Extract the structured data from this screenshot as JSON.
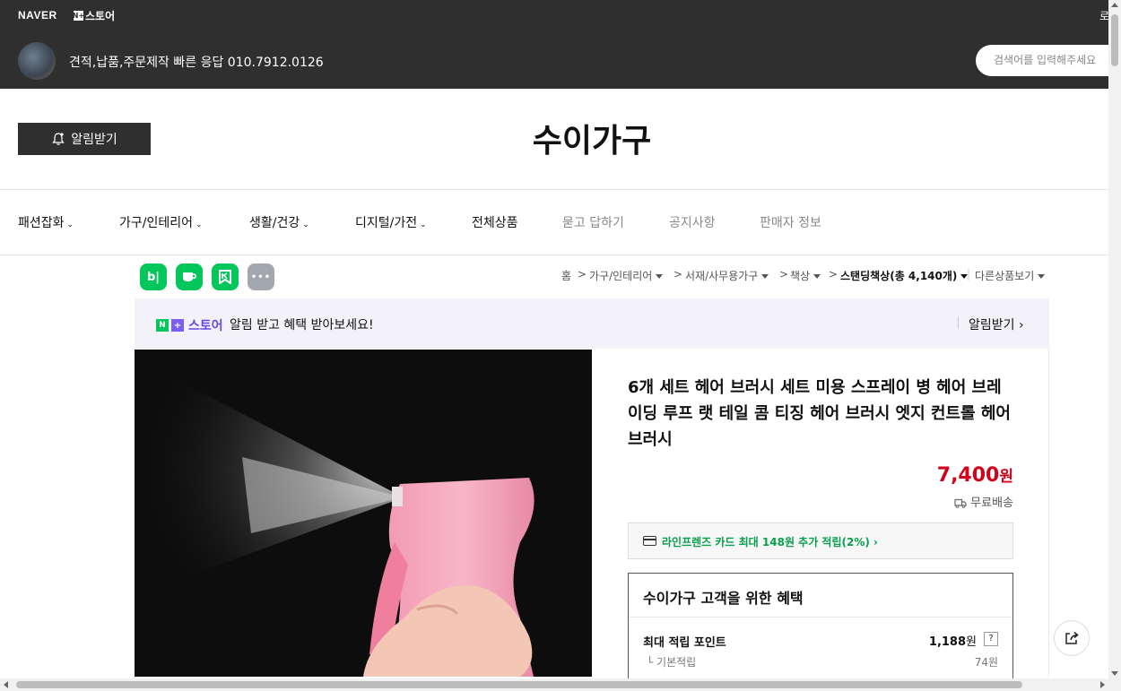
{
  "header": {
    "naver_logo": "NAVER",
    "store_logo_box": "N+",
    "store_logo_text": "스토어",
    "login_cut": "로",
    "seller_description": "견적,납품,주문제작 빠른 응답 010.7912.0126",
    "search_placeholder": "검색어를 입력해주세요"
  },
  "store": {
    "alarm_button_label": "알림받기",
    "title": "수이가구"
  },
  "nav": {
    "items": [
      {
        "label": "패션잡화",
        "dropdown": true
      },
      {
        "label": "가구/인테리어",
        "dropdown": true
      },
      {
        "label": "생활/건강",
        "dropdown": true
      },
      {
        "label": "디지털/가전",
        "dropdown": true
      },
      {
        "label": "전체상품",
        "dropdown": false
      },
      {
        "label": "묻고 답하기",
        "dropdown": false
      },
      {
        "label": "공지사항",
        "dropdown": false
      },
      {
        "label": "판매자 정보",
        "dropdown": false
      }
    ]
  },
  "social": {
    "band_label": "b|",
    "more_label": "•••"
  },
  "breadcrumb": {
    "home": "홈",
    "level1": "가구/인테리어",
    "level2": "서재/사무용가구",
    "level3": "책상",
    "current": "스탠딩책상",
    "count": "(총 4,140개)",
    "other": "다른상품보기",
    "separator": ">"
  },
  "banner": {
    "logo_n": "N",
    "logo_plus": "+",
    "logo_text": "스토어",
    "message": "알림 받고 혜택 받아보세요!",
    "action": "알림받기 ›"
  },
  "product": {
    "title": "6개 세트 헤어 브러시 세트 미용 스프레이 병 헤어 브레이딩 루프 랫 테일 콤 티징 헤어 브러시 엣지 컨트롤 헤어 브러시",
    "price": "7,400",
    "price_unit": "원",
    "delivery": "무료배송",
    "card_benefit": "라인프렌즈 카드 최대 148원 추가 적립(2%) ›"
  },
  "benefits": {
    "heading": "수이가구 고객을 위한 혜택",
    "max_points_label": "최대 적립 포인트",
    "max_points_value": "1,188",
    "max_points_unit": "원",
    "help": "?",
    "basic_label": "└ 기본적립",
    "basic_value": "74원"
  },
  "colors": {
    "dark_header": "#2f2f2f",
    "price_red": "#d0021b",
    "naver_green": "#03c75a",
    "store_purple": "#6a45e8"
  }
}
